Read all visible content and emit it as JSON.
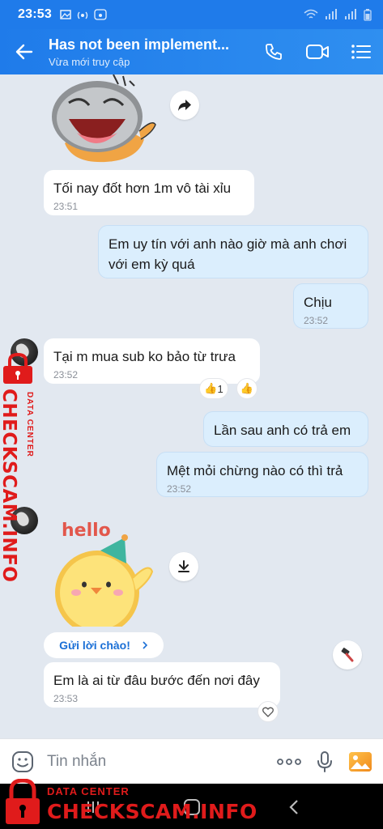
{
  "status": {
    "time": "23:53"
  },
  "header": {
    "title": "Has not been implement...",
    "subtitle": "Vừa mới truy cập"
  },
  "messages": [
    {
      "text": "Tối nay đốt hơn 1m vô tài xỉu",
      "time": "23:51"
    },
    {
      "text_line1": "Em uy tín với anh nào giờ mà anh chơi",
      "text_line2": "với em kỳ quá"
    },
    {
      "text": "Chịu",
      "time": "23:52"
    },
    {
      "text": "Tại m mua sub ko bảo từ trưa",
      "time": "23:52",
      "reaction_count": "1"
    },
    {
      "text": "Lần sau anh có trả em"
    },
    {
      "text": "Mệt mỏi chừng nào có thì trả",
      "time": "23:52"
    },
    {
      "text": "Em là ai từ đâu bước đến nơi đây",
      "time": "23:53"
    }
  ],
  "sticker_hello_text": "hello",
  "greet_button": {
    "label": "Gửi lời chào!"
  },
  "input": {
    "placeholder": "Tin nhắn"
  },
  "watermark": {
    "small": "DATA CENTER",
    "big": "CHECKSCAM.INFO"
  },
  "colors": {
    "header_blue": "#1f7bea",
    "chat_bg": "#e2e8f0",
    "outgoing_bubble": "#dbeefd",
    "watermark_red": "#e01b1b"
  }
}
